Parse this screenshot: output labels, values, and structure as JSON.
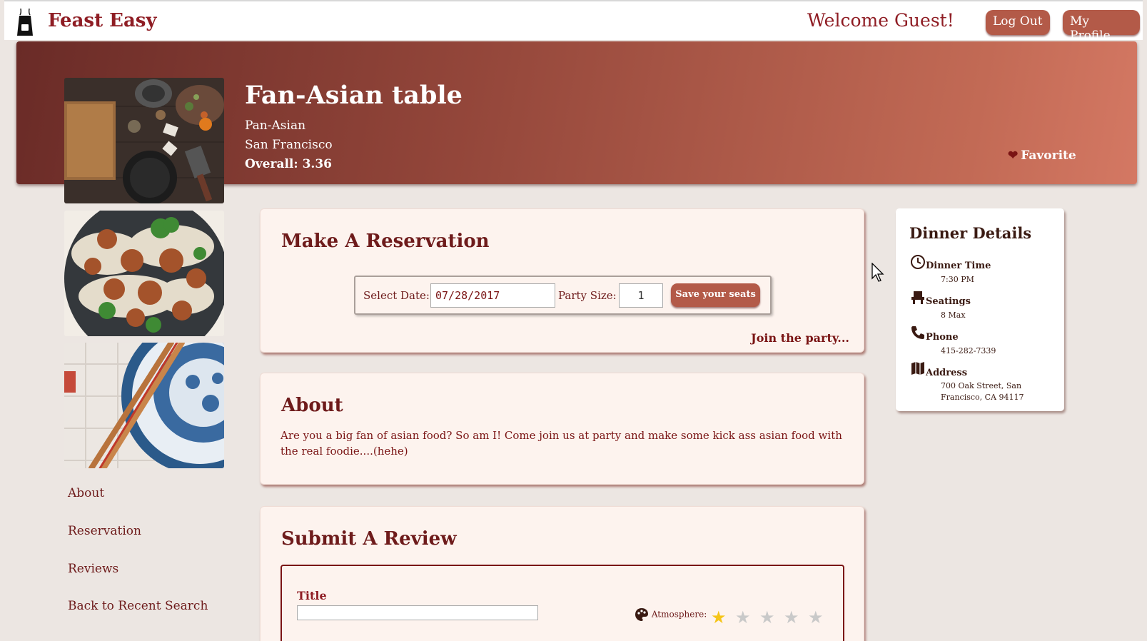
{
  "header": {
    "brand": "Feast Easy",
    "welcome": "Welcome Guest!",
    "logout_label": "Log Out",
    "profile_label": "My Profile"
  },
  "hero": {
    "title": "Fan-Asian table",
    "cuisine": "Pan-Asian",
    "city": "San Francisco",
    "overall": "Overall: 3.36",
    "favorite_label": "Favorite",
    "favorite_icon": "heart-icon"
  },
  "side_nav": {
    "items": [
      {
        "label": "About"
      },
      {
        "label": "Reservation"
      },
      {
        "label": "Reviews"
      },
      {
        "label": "Back to Recent Search"
      }
    ]
  },
  "reservation": {
    "title": "Make A Reservation",
    "date_label": "Select Date:",
    "date_value": "07/28/2017",
    "party_label": "Party Size:",
    "party_value": "1",
    "save_label": "Save your seats",
    "join_link": "Join the party..."
  },
  "about": {
    "title": "About",
    "text": "Are you a big fan of asian food? So am I! Come join us at party and make some kick ass asian food with the real foodie....(hehe)"
  },
  "review": {
    "title": "Submit A Review",
    "title_label": "Title",
    "atmosphere_label": "Atmosphere:",
    "atmosphere_rating": 1,
    "atmosphere_max": 5
  },
  "details": {
    "title": "Dinner Details",
    "items": [
      {
        "label": "Dinner Time",
        "value": "7:30 PM",
        "icon": "clock-icon"
      },
      {
        "label": "Seatings",
        "value": "8 Max",
        "icon": "chair-icon"
      },
      {
        "label": "Phone",
        "value": "415-282-7339",
        "icon": "phone-icon"
      },
      {
        "label": "Address",
        "value": "700 Oak Street, San Francisco, CA 94117",
        "icon": "map-icon"
      }
    ]
  },
  "colors": {
    "brand": "#8f1d24",
    "button": "#b35a48",
    "card_bg": "#fdf3ee",
    "page_bg": "#ece6e2",
    "star_on": "#f5c518"
  }
}
